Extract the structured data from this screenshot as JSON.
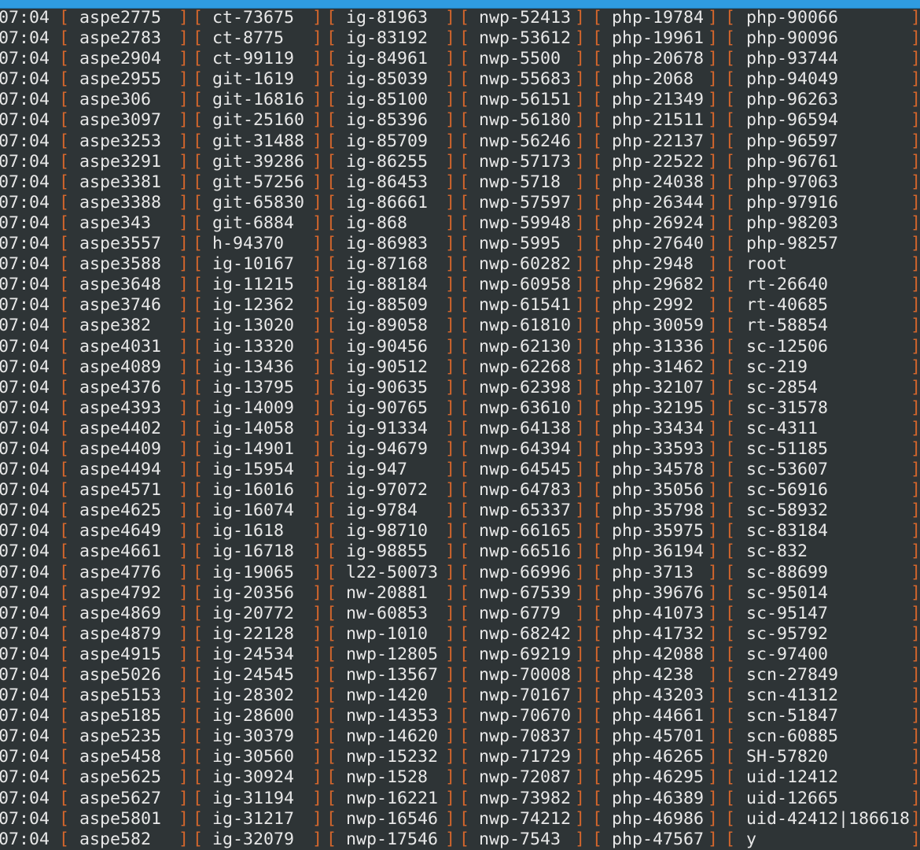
{
  "terminal": {
    "colors": {
      "background": "#2e3436",
      "text": "#e8e8e8",
      "bracket": "#d4662c",
      "title_strip": "#2f9be0"
    },
    "rows": [
      {
        "time": "07:04",
        "cols": [
          "aspe2775",
          "ct-73675",
          "ig-81963",
          "nwp-52413",
          "php-19784",
          "php-90066"
        ]
      },
      {
        "time": "07:04",
        "cols": [
          "aspe2783",
          "ct-8775",
          "ig-83192",
          "nwp-53612",
          "php-19961",
          "php-90096"
        ]
      },
      {
        "time": "07:04",
        "cols": [
          "aspe2904",
          "ct-99119",
          "ig-84961",
          "nwp-5500",
          "php-20678",
          "php-93744"
        ]
      },
      {
        "time": "07:04",
        "cols": [
          "aspe2955",
          "git-1619",
          "ig-85039",
          "nwp-55683",
          "php-2068",
          "php-94049"
        ]
      },
      {
        "time": "07:04",
        "cols": [
          "aspe306",
          "git-16816",
          "ig-85100",
          "nwp-56151",
          "php-21349",
          "php-96263"
        ]
      },
      {
        "time": "07:04",
        "cols": [
          "aspe3097",
          "git-25160",
          "ig-85396",
          "nwp-56180",
          "php-21511",
          "php-96594"
        ]
      },
      {
        "time": "07:04",
        "cols": [
          "aspe3253",
          "git-31488",
          "ig-85709",
          "nwp-56246",
          "php-22137",
          "php-96597"
        ]
      },
      {
        "time": "07:04",
        "cols": [
          "aspe3291",
          "git-39286",
          "ig-86255",
          "nwp-57173",
          "php-22522",
          "php-96761"
        ]
      },
      {
        "time": "07:04",
        "cols": [
          "aspe3381",
          "git-57256",
          "ig-86453",
          "nwp-5718",
          "php-24038",
          "php-97063"
        ]
      },
      {
        "time": "07:04",
        "cols": [
          "aspe3388",
          "git-65830",
          "ig-86661",
          "nwp-57597",
          "php-26344",
          "php-97916"
        ]
      },
      {
        "time": "07:04",
        "cols": [
          "aspe343",
          "git-6884",
          "ig-868",
          "nwp-59948",
          "php-26924",
          "php-98203"
        ]
      },
      {
        "time": "07:04",
        "cols": [
          "aspe3557",
          "h-94370",
          "ig-86983",
          "nwp-5995",
          "php-27640",
          "php-98257"
        ]
      },
      {
        "time": "07:04",
        "cols": [
          "aspe3588",
          "ig-10167",
          "ig-87168",
          "nwp-60282",
          "php-2948",
          "root"
        ]
      },
      {
        "time": "07:04",
        "cols": [
          "aspe3648",
          "ig-11215",
          "ig-88184",
          "nwp-60958",
          "php-29682",
          "rt-26640"
        ]
      },
      {
        "time": "07:04",
        "cols": [
          "aspe3746",
          "ig-12362",
          "ig-88509",
          "nwp-61541",
          "php-2992",
          "rt-40685"
        ]
      },
      {
        "time": "07:04",
        "cols": [
          "aspe382",
          "ig-13020",
          "ig-89058",
          "nwp-61810",
          "php-30059",
          "rt-58854"
        ]
      },
      {
        "time": "07:04",
        "cols": [
          "aspe4031",
          "ig-13320",
          "ig-90456",
          "nwp-62130",
          "php-31336",
          "sc-12506"
        ]
      },
      {
        "time": "07:04",
        "cols": [
          "aspe4089",
          "ig-13436",
          "ig-90512",
          "nwp-62268",
          "php-31462",
          "sc-219"
        ]
      },
      {
        "time": "07:04",
        "cols": [
          "aspe4376",
          "ig-13795",
          "ig-90635",
          "nwp-62398",
          "php-32107",
          "sc-2854"
        ]
      },
      {
        "time": "07:04",
        "cols": [
          "aspe4393",
          "ig-14009",
          "ig-90765",
          "nwp-63610",
          "php-32195",
          "sc-31578"
        ]
      },
      {
        "time": "07:04",
        "cols": [
          "aspe4402",
          "ig-14058",
          "ig-91334",
          "nwp-64138",
          "php-33434",
          "sc-4311"
        ]
      },
      {
        "time": "07:04",
        "cols": [
          "aspe4409",
          "ig-14901",
          "ig-94679",
          "nwp-64394",
          "php-33593",
          "sc-51185"
        ]
      },
      {
        "time": "07:04",
        "cols": [
          "aspe4494",
          "ig-15954",
          "ig-947",
          "nwp-64545",
          "php-34578",
          "sc-53607"
        ]
      },
      {
        "time": "07:04",
        "cols": [
          "aspe4571",
          "ig-16016",
          "ig-97072",
          "nwp-64783",
          "php-35056",
          "sc-56916"
        ]
      },
      {
        "time": "07:04",
        "cols": [
          "aspe4625",
          "ig-16074",
          "ig-9784",
          "nwp-65337",
          "php-35798",
          "sc-58932"
        ]
      },
      {
        "time": "07:04",
        "cols": [
          "aspe4649",
          "ig-1618",
          "ig-98710",
          "nwp-66165",
          "php-35975",
          "sc-83184"
        ]
      },
      {
        "time": "07:04",
        "cols": [
          "aspe4661",
          "ig-16718",
          "ig-98855",
          "nwp-66516",
          "php-36194",
          "sc-832"
        ]
      },
      {
        "time": "07:04",
        "cols": [
          "aspe4776",
          "ig-19065",
          "l22-50073",
          "nwp-66996",
          "php-3713",
          "sc-88699"
        ]
      },
      {
        "time": "07:04",
        "cols": [
          "aspe4792",
          "ig-20356",
          "nw-20881",
          "nwp-67539",
          "php-39676",
          "sc-95014"
        ]
      },
      {
        "time": "07:04",
        "cols": [
          "aspe4869",
          "ig-20772",
          "nw-60853",
          "nwp-6779",
          "php-41073",
          "sc-95147"
        ]
      },
      {
        "time": "07:04",
        "cols": [
          "aspe4879",
          "ig-22128",
          "nwp-1010",
          "nwp-68242",
          "php-41732",
          "sc-95792"
        ]
      },
      {
        "time": "07:04",
        "cols": [
          "aspe4915",
          "ig-24534",
          "nwp-12805",
          "nwp-69219",
          "php-42088",
          "sc-97400"
        ]
      },
      {
        "time": "07:04",
        "cols": [
          "aspe5026",
          "ig-24545",
          "nwp-13567",
          "nwp-70008",
          "php-4238",
          "scn-27849"
        ]
      },
      {
        "time": "07:04",
        "cols": [
          "aspe5153",
          "ig-28302",
          "nwp-1420",
          "nwp-70167",
          "php-43203",
          "scn-41312"
        ]
      },
      {
        "time": "07:04",
        "cols": [
          "aspe5185",
          "ig-28600",
          "nwp-14353",
          "nwp-70670",
          "php-44661",
          "scn-51847"
        ]
      },
      {
        "time": "07:04",
        "cols": [
          "aspe5235",
          "ig-30379",
          "nwp-14620",
          "nwp-70837",
          "php-45701",
          "scn-60885"
        ]
      },
      {
        "time": "07:04",
        "cols": [
          "aspe5458",
          "ig-30560",
          "nwp-15232",
          "nwp-71729",
          "php-46265",
          "SH-57820"
        ]
      },
      {
        "time": "07:04",
        "cols": [
          "aspe5625",
          "ig-30924",
          "nwp-1528",
          "nwp-72087",
          "php-46295",
          "uid-12412"
        ]
      },
      {
        "time": "07:04",
        "cols": [
          "aspe5627",
          "ig-31194",
          "nwp-16221",
          "nwp-73982",
          "php-46389",
          "uid-12665"
        ]
      },
      {
        "time": "07:04",
        "cols": [
          "aspe5801",
          "ig-31217",
          "nwp-16546",
          "nwp-74212",
          "php-46986",
          "uid-42412|186618"
        ]
      },
      {
        "time": "07:04",
        "cols": [
          "aspe582",
          "ig-32079",
          "nwp-17546",
          "nwp-7543",
          "php-47567",
          "y"
        ]
      }
    ]
  }
}
